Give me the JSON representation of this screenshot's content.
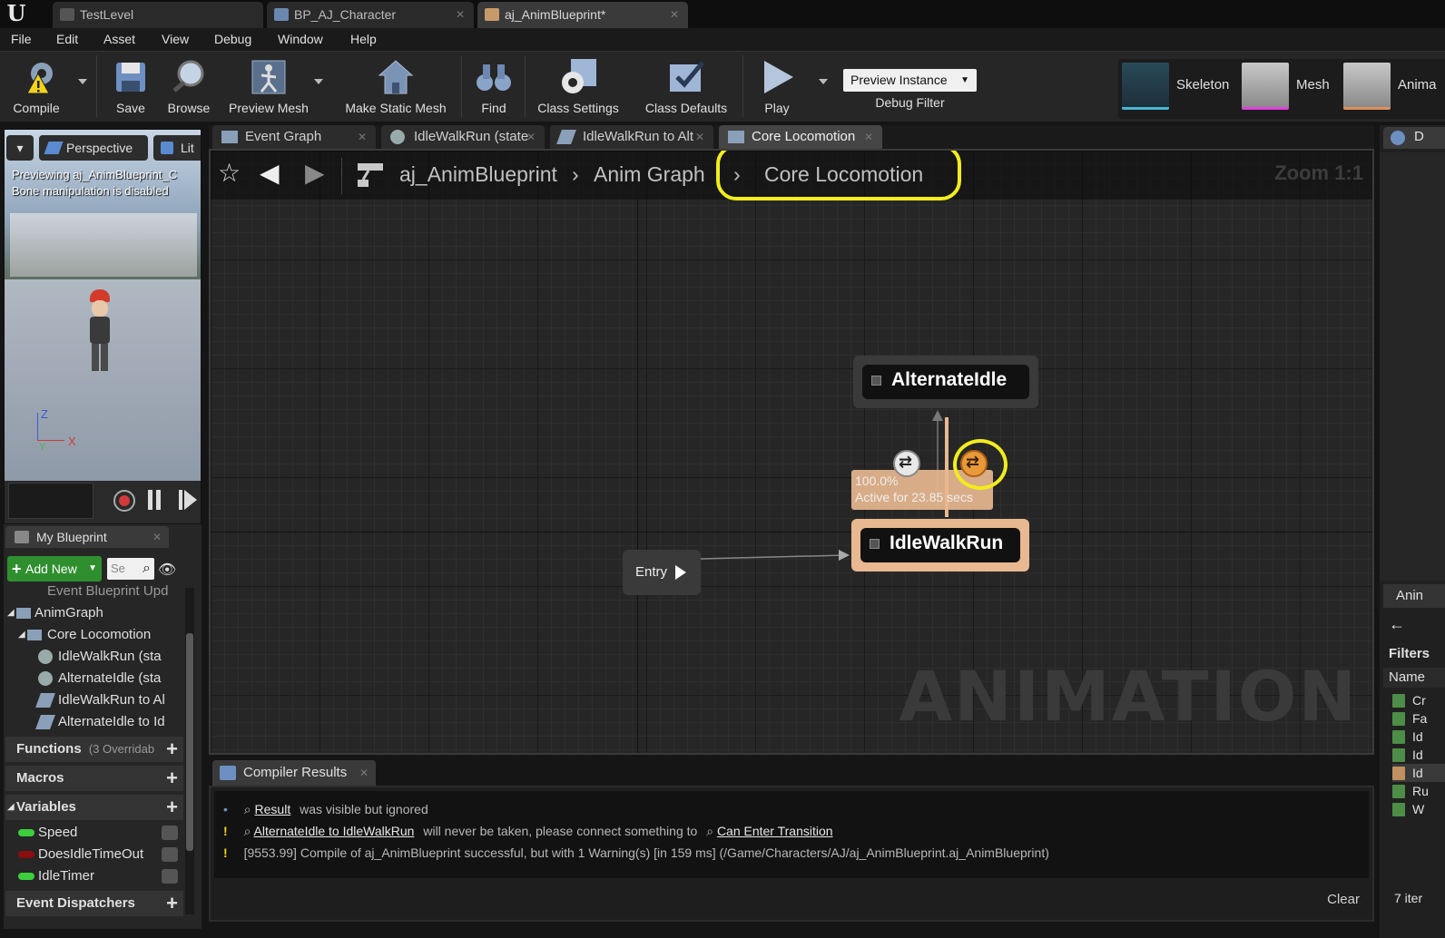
{
  "title_tabs": [
    {
      "label": "TestLevel",
      "active": false
    },
    {
      "label": "BP_AJ_Character",
      "active": false
    },
    {
      "label": "aj_AnimBlueprint*",
      "active": true
    }
  ],
  "menu": [
    "File",
    "Edit",
    "Asset",
    "View",
    "Debug",
    "Window",
    "Help"
  ],
  "toolbar": {
    "compile": "Compile",
    "save": "Save",
    "browse": "Browse",
    "preview_mesh": "Preview Mesh",
    "make_static_mesh": "Make Static Mesh",
    "find": "Find",
    "class_settings": "Class Settings",
    "class_defaults": "Class Defaults",
    "play": "Play",
    "preview_instance": "Preview Instance",
    "debug_filter": "Debug Filter",
    "skeleton": "Skeleton",
    "mesh": "Mesh",
    "animation": "Anima"
  },
  "viewport": {
    "perspective": "Perspective",
    "lit": "Lit",
    "overlay_line1": "Previewing aj_AnimBlueprint_C",
    "overlay_line2": "Bone manipulation is disabled",
    "axis_z": "Z",
    "axis_x": "X",
    "axis_y": "Y"
  },
  "my_blueprint": {
    "tab": "My Blueprint",
    "add_new": "Add New",
    "search_placeholder": "Se",
    "tree": [
      "Event Blueprint Upd",
      "AnimGraph",
      "Core Locomotion",
      "IdleWalkRun (sta",
      "AlternateIdle (sta",
      "IdleWalkRun to Al",
      "AlternateIdle to Id"
    ],
    "functions": "Functions",
    "functions_sub": "(3 Overridab",
    "macros": "Macros",
    "variables": "Variables",
    "variable_list": [
      {
        "name": "Speed",
        "color": "#3ccf3c"
      },
      {
        "name": "DoesIdleTimeOut",
        "color": "#8b0e0e"
      },
      {
        "name": "IdleTimer",
        "color": "#3ccf3c"
      }
    ],
    "event_dispatchers": "Event Dispatchers"
  },
  "graph_tabs": [
    {
      "label": "Event Graph",
      "active": false
    },
    {
      "label": "IdleWalkRun (state",
      "active": false
    },
    {
      "label": "IdleWalkRun to Alt",
      "active": false
    },
    {
      "label": "Core Locomotion",
      "active": true
    }
  ],
  "graph": {
    "breadcrumb": [
      "aj_AnimBlueprint",
      "Anim Graph",
      "Core Locomotion"
    ],
    "zoom": "Zoom 1:1",
    "watermark": "ANIMATION",
    "nodes": {
      "alternate_idle": "AlternateIdle",
      "idle_walk_run": "IdleWalkRun",
      "entry": "Entry"
    },
    "debug_percent": "100.0%",
    "debug_active": "Active for 23.85 secs"
  },
  "compiler": {
    "tab": "Compiler Results",
    "line1_link": "Result",
    "line1_text": "was visible but ignored",
    "line2_link": "AlternateIdle to IdleWalkRun",
    "line2_text": "will never be taken, please connect something to",
    "line2_link2": "Can Enter Transition",
    "line3_text": "[9553.99] Compile of aj_AnimBlueprint successful, but with 1 Warning(s) [in 159 ms] (/Game/Characters/AJ/aj_AnimBlueprint.aj_AnimBlueprint)",
    "clear": "Clear"
  },
  "right_panel": {
    "top_label": "D",
    "anim_label": "Anin",
    "filters": "Filters",
    "name": "Name",
    "files": [
      "Cr",
      "Fa",
      "Id",
      "Id",
      "Id",
      "Ru",
      "W"
    ],
    "items_count": "7 iter"
  },
  "colors": {
    "highlight": "#f2ec1e",
    "active_state": "#e8b890",
    "add_new_green": "#2f8f2f"
  }
}
